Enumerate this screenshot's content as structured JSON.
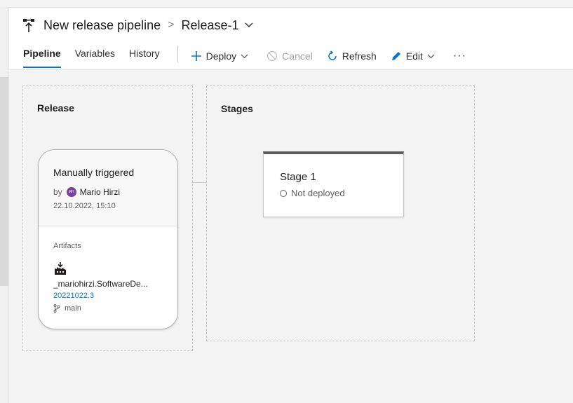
{
  "header": {
    "pipeline_name": "New release pipeline",
    "breadcrumb_separator": ">",
    "release_name": "Release-1"
  },
  "tabs": [
    {
      "label": "Pipeline",
      "active": true
    },
    {
      "label": "Variables",
      "active": false
    },
    {
      "label": "History",
      "active": false
    }
  ],
  "commands": {
    "deploy": "Deploy",
    "cancel": "Cancel",
    "refresh": "Refresh",
    "edit": "Edit",
    "more": "···"
  },
  "release_panel": {
    "title": "Release",
    "trigger": "Manually triggered",
    "by_label": "by",
    "user_initials": "MH",
    "user_name": "Mario Hirzi",
    "date": "22.10.2022, 15:10",
    "artifacts_label": "Artifacts",
    "artifact_name": "_mariohirzi.SoftwareDe...",
    "artifact_version": "20221022.3",
    "branch": "main"
  },
  "stages_panel": {
    "title": "Stages",
    "stage_name": "Stage 1",
    "stage_status": "Not deployed"
  },
  "colors": {
    "accent": "#0078d4",
    "avatar": "#7a3fa0",
    "stage_bar": "#605e5c",
    "background": "#f3f3f3"
  }
}
